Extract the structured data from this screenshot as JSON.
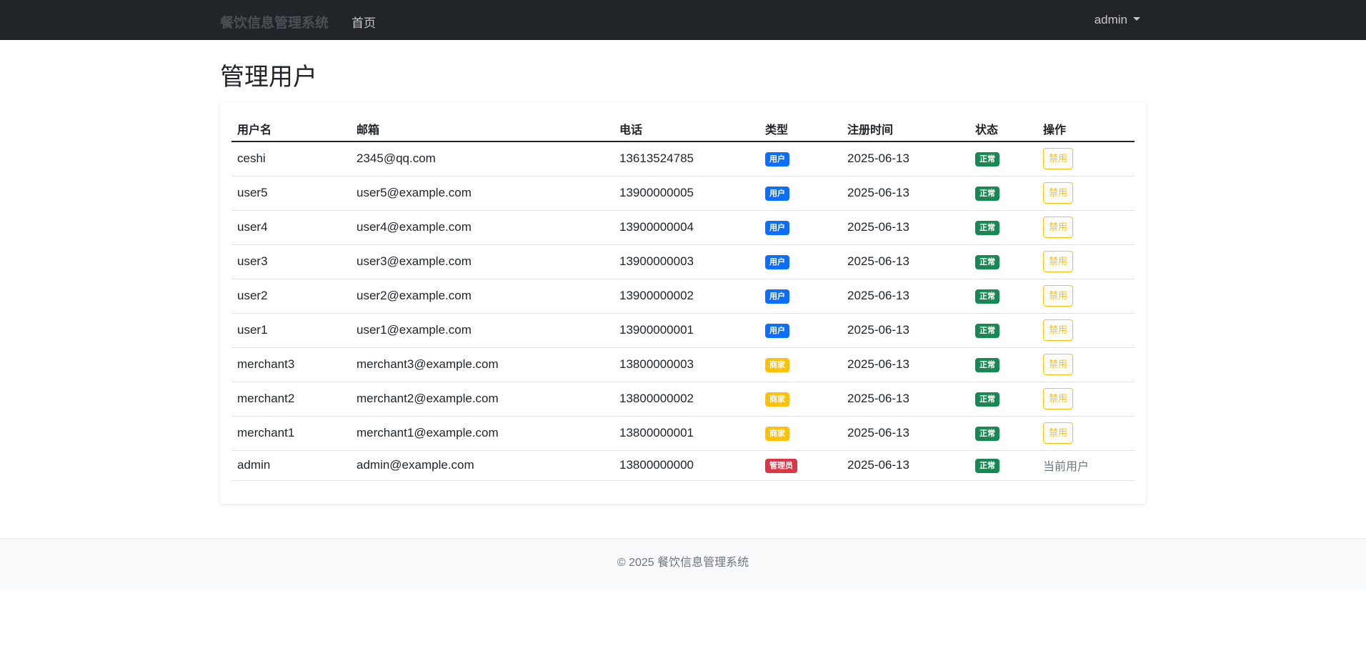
{
  "navbar": {
    "brand": "餐饮信息管理系统",
    "home": "首页",
    "user": "admin"
  },
  "page": {
    "title": "管理用户"
  },
  "table": {
    "headers": [
      "用户名",
      "邮箱",
      "电话",
      "类型",
      "注册时间",
      "状态",
      "操作"
    ],
    "rows": [
      {
        "username": "ceshi",
        "email": "2345@qq.com",
        "phone": "13613524785",
        "type": "用户",
        "type_kind": "user",
        "date": "2025-06-13",
        "status": "正常",
        "action": "禁用"
      },
      {
        "username": "user5",
        "email": "user5@example.com",
        "phone": "13900000005",
        "type": "用户",
        "type_kind": "user",
        "date": "2025-06-13",
        "status": "正常",
        "action": "禁用"
      },
      {
        "username": "user4",
        "email": "user4@example.com",
        "phone": "13900000004",
        "type": "用户",
        "type_kind": "user",
        "date": "2025-06-13",
        "status": "正常",
        "action": "禁用"
      },
      {
        "username": "user3",
        "email": "user3@example.com",
        "phone": "13900000003",
        "type": "用户",
        "type_kind": "user",
        "date": "2025-06-13",
        "status": "正常",
        "action": "禁用"
      },
      {
        "username": "user2",
        "email": "user2@example.com",
        "phone": "13900000002",
        "type": "用户",
        "type_kind": "user",
        "date": "2025-06-13",
        "status": "正常",
        "action": "禁用"
      },
      {
        "username": "user1",
        "email": "user1@example.com",
        "phone": "13900000001",
        "type": "用户",
        "type_kind": "user",
        "date": "2025-06-13",
        "status": "正常",
        "action": "禁用"
      },
      {
        "username": "merchant3",
        "email": "merchant3@example.com",
        "phone": "13800000003",
        "type": "商家",
        "type_kind": "merchant",
        "date": "2025-06-13",
        "status": "正常",
        "action": "禁用"
      },
      {
        "username": "merchant2",
        "email": "merchant2@example.com",
        "phone": "13800000002",
        "type": "商家",
        "type_kind": "merchant",
        "date": "2025-06-13",
        "status": "正常",
        "action": "禁用"
      },
      {
        "username": "merchant1",
        "email": "merchant1@example.com",
        "phone": "13800000001",
        "type": "商家",
        "type_kind": "merchant",
        "date": "2025-06-13",
        "status": "正常",
        "action": "禁用"
      },
      {
        "username": "admin",
        "email": "admin@example.com",
        "phone": "13800000000",
        "type": "管理员",
        "type_kind": "admin",
        "date": "2025-06-13",
        "status": "正常",
        "action": "当前用户"
      }
    ]
  },
  "footer": {
    "text": "© 2025 餐饮信息管理系统"
  },
  "colors": {
    "navbar_bg": "#212529",
    "badge_user": "#0d6efd",
    "badge_merchant": "#ffc107",
    "badge_admin": "#dc3545",
    "badge_ok": "#198754",
    "btn_warning": "#ffc107"
  }
}
